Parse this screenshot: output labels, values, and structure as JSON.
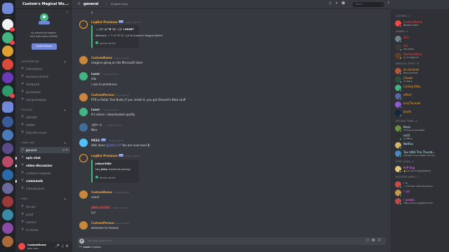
{
  "server": {
    "name": "Custom's Magical Wo...",
    "chevron_icon": "chevron-down-icon"
  },
  "invite": {
    "text_line1": "An adventure begins.",
    "text_line2": "Let's add some friends!",
    "button": "Invite People"
  },
  "categories": {
    "information": "INFORMATION",
    "socials": "SOCIALS",
    "fan_hub": "FANS HUB",
    "misc": "MISC"
  },
  "channels": {
    "information": [
      "information",
      "announcements",
      "starboard",
      "giveaways",
      "req-giveaways"
    ],
    "socials": [
      "uploads",
      "twitter",
      "help-the-cause"
    ],
    "fan_hub": [
      "general",
      "epic-chat",
      "video-discussion",
      "customs-requests",
      "commands",
      "introductions"
    ],
    "misc": [
      "fan-art",
      "proof",
      "memes",
      "tv-shows"
    ]
  },
  "user_panel": {
    "name": "CustomName",
    "status": "NEW VIDE..."
  },
  "chat": {
    "channel": "general",
    "topic": "(English Only)",
    "search_placeholder": "Search",
    "top_stub": "y",
    "messages": [
      {
        "author": "LogBot Premium",
        "color": "#f8a532",
        "bot_tag": "BOT",
        "time": "Today at 20:30",
        "embed_title": "┌ ✧ﾟ*ヽ(*´∀`*)ﾉ ✧ﾟ*  ✦#0467",
        "embed_desc": "Welcome, ✧ﾟ*ヽ(*´∀`*)ﾉ ✧ﾟ* to Custom's Magical World!",
        "embed_footer": "Member #6,354"
      },
      {
        "author": "CustomName",
        "color": "#f8a532",
        "time": "Today at 20:35",
        "lines": [
          "imagine going on the Microsoft store"
        ]
      },
      {
        "author": "Loser",
        "color": "#dcddde",
        "time": "Today at 20:35",
        "lines": [
          "ello",
          "i use it sometimes"
        ]
      },
      {
        "author": "CustomPerson",
        "color": "#f8a532",
        "time": "Today at 20:37",
        "lines": [
          "PTB is Public Test Build, if you install it, you get Discord's Beta stuff",
          "It's where i downloaded spotify"
        ]
      },
      {
        "author": "コワート",
        "color": "#dcddde",
        "time": "Today at 20:41",
        "lines": [
          "Nice"
        ]
      },
      {
        "author": "MEE6",
        "color": "#dcddde",
        "bot_tag": "BOT",
        "time": "Today at 20:41",
        "line_prefix": "Well done ",
        "mention": "@コワート",
        "line_suffix": "! You are now level ",
        "level": "1",
        "line_end": "!"
      },
      {
        "author": "LogBot Premium",
        "color": "#f8a532",
        "bot_tag": "BOT",
        "time": "Today at 20:42",
        "embed_title": "Jelko#3680",
        "embed_desc_prefix": "Hey ",
        "embed_desc_name": "Jelko",
        "embed_desc_suffix": ", thanks for joining!",
        "embed_footer": "Member #6,355"
      },
      {
        "author": "CustomName",
        "color": "#f8a532",
        "time": "Today at 20:45",
        "lines": [
          "oooof"
        ]
      },
      {
        "author": "ARKadi4301",
        "color": "#f04747",
        "time": "Today at 20:49",
        "lines": [
          "Lol"
        ]
      },
      {
        "author": "CustomPerson",
        "color": "#f8a532",
        "time": "Today at 20:52",
        "lines": [
          "welcome to heaven"
        ]
      }
    ],
    "composer_placeholder": "Message #general",
    "typing_user": "Loser",
    "typing_suffix": " is typing..."
  },
  "members": {
    "groups": [
      {
        "title": "CUSTOM—1",
        "members": [
          {
            "name": "CustomName",
            "sub": "🎬 NEW VIDEO!",
            "color": "#f04747",
            "avatar": "#f04747",
            "status": "#f04747"
          }
        ]
      },
      {
        "title": "ADMIN—4",
        "members": [
          {
            "name": "1K3",
            "sub": "",
            "color": "#f04747",
            "avatar": "#747f8d",
            "status": "#43b581"
          },
          {
            "name": "din",
            "sub": "Has Shade",
            "color": "#f04747",
            "avatar": "#3b3b3b",
            "status": "#43b581"
          },
          {
            "name": "RenYeahMine",
            "sub": "◎ I'm awake sk",
            "color": "#f04747",
            "avatar": "#5a3e2b",
            "status": "#faa61a"
          }
        ]
      },
      {
        "title": "MAGICAL STAFF—6",
        "members": [
          {
            "name": "æ minimeli",
            "sub": "Playing Rocket",
            "color": "#f8a532",
            "avatar": "#b5553c",
            "status": "#43b581"
          },
          {
            "name": "Cheatr",
            "sub": "★ Status",
            "color": "#f8a532",
            "avatar": "#2e4f3a",
            "status": "#43b581"
          },
          {
            "name": "Coding Kitty",
            "sub": "",
            "color": "#f8a532",
            "avatar": "#43b581",
            "status": "#43b581"
          },
          {
            "name": "effect",
            "sub": "",
            "color": "#f8a532",
            "avatar": "#5865a2",
            "status": "#43b581"
          },
          {
            "name": "IceyThunder",
            "sub": "",
            "color": "#f8a532",
            "avatar": "#8f5bd6",
            "status": "#747f8d"
          },
          {
            "name": "Jdude",
            "sub": "",
            "color": "#f8a532",
            "avatar": "#0e2a3a",
            "status": "#747f8d"
          }
        ]
      },
      {
        "title": "UPLOAD TEAM—4",
        "members": [
          {
            "name": "Bean",
            "sub": "🎮 Playing VALORANT",
            "color": "#b9f2ff",
            "avatar": "#6b8f3a",
            "status": "#43b581"
          },
          {
            "name": "nicO",
            "sub": "★ Offline",
            "color": "#b9f2ff",
            "avatar": "#2f2f2f",
            "status": "#43b581"
          },
          {
            "name": "NotFax",
            "sub": "",
            "color": "#b9f2ff",
            "avatar": "#d4b06a",
            "status": "#43b581"
          },
          {
            "name": "Tux (AKA The Thumb...",
            "sub": "Thought I'd be a better user tha",
            "color": "#b9f2ff",
            "avatar": "#4a86c8",
            "status": "#43b581"
          }
        ]
      },
      {
        "title": "HYPE GODS—1",
        "members": [
          {
            "name": "RsP-dog",
            "sub": "🔥 Join discord.gg/HyPeGoD",
            "color": "#ff73fa",
            "avatar": "#e8c37a",
            "status": "#43b581"
          }
        ]
      },
      {
        "title": "BOOSTER ARMY—7",
        "members": [
          {
            "name": "! ✭",
            "sub": "🎵 bdf Tank! #TanzOhneFarbe",
            "color": "#ff73fa",
            "avatar": "#c94a4a",
            "status": "#43b581"
          },
          {
            "name": "! cal",
            "sub": "",
            "color": "#ff73fa",
            "avatar": "#c99a4a",
            "status": "#43b581"
          },
          {
            "name": "! polska",
            "sub": "https://discord.gg/TalkSnowTV",
            "color": "#ff73fa",
            "avatar": "#b94a4a",
            "status": "#43b581"
          }
        ]
      }
    ]
  }
}
